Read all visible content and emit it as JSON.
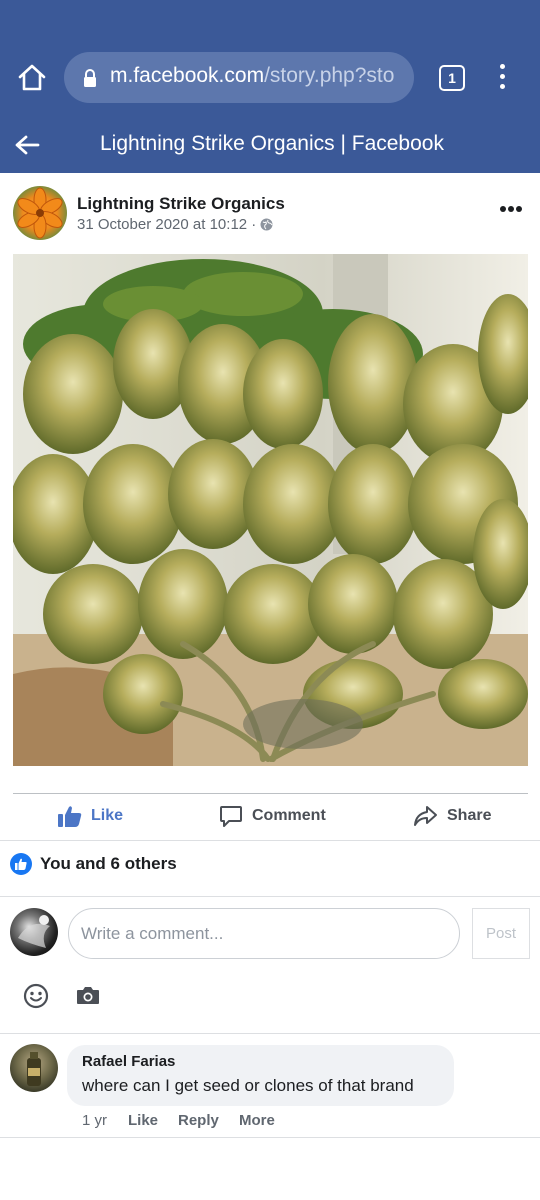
{
  "browser": {
    "url_host": "m.facebook.com",
    "url_path": "/story.php?sto",
    "tab_count": "1"
  },
  "header": {
    "title": "Lightning Strike Organics | Facebook"
  },
  "post": {
    "author": "Lightning Strike Organics",
    "timestamp": "31 October 2020 at 10:12 ·",
    "actions": {
      "like": "Like",
      "comment": "Comment",
      "share": "Share"
    },
    "reactions_summary": "You and 6 others"
  },
  "composer": {
    "placeholder": "Write a comment...",
    "post_label": "Post"
  },
  "comments": [
    {
      "author": "Rafael Farias",
      "text": "where can I get seed or clones of that brand",
      "time": "1 yr",
      "like_label": "Like",
      "reply_label": "Reply",
      "more_label": "More"
    }
  ],
  "colors": {
    "brand_blue": "#3b5998",
    "like_blue": "#4c76c6",
    "reaction_blue": "#1877f2"
  }
}
